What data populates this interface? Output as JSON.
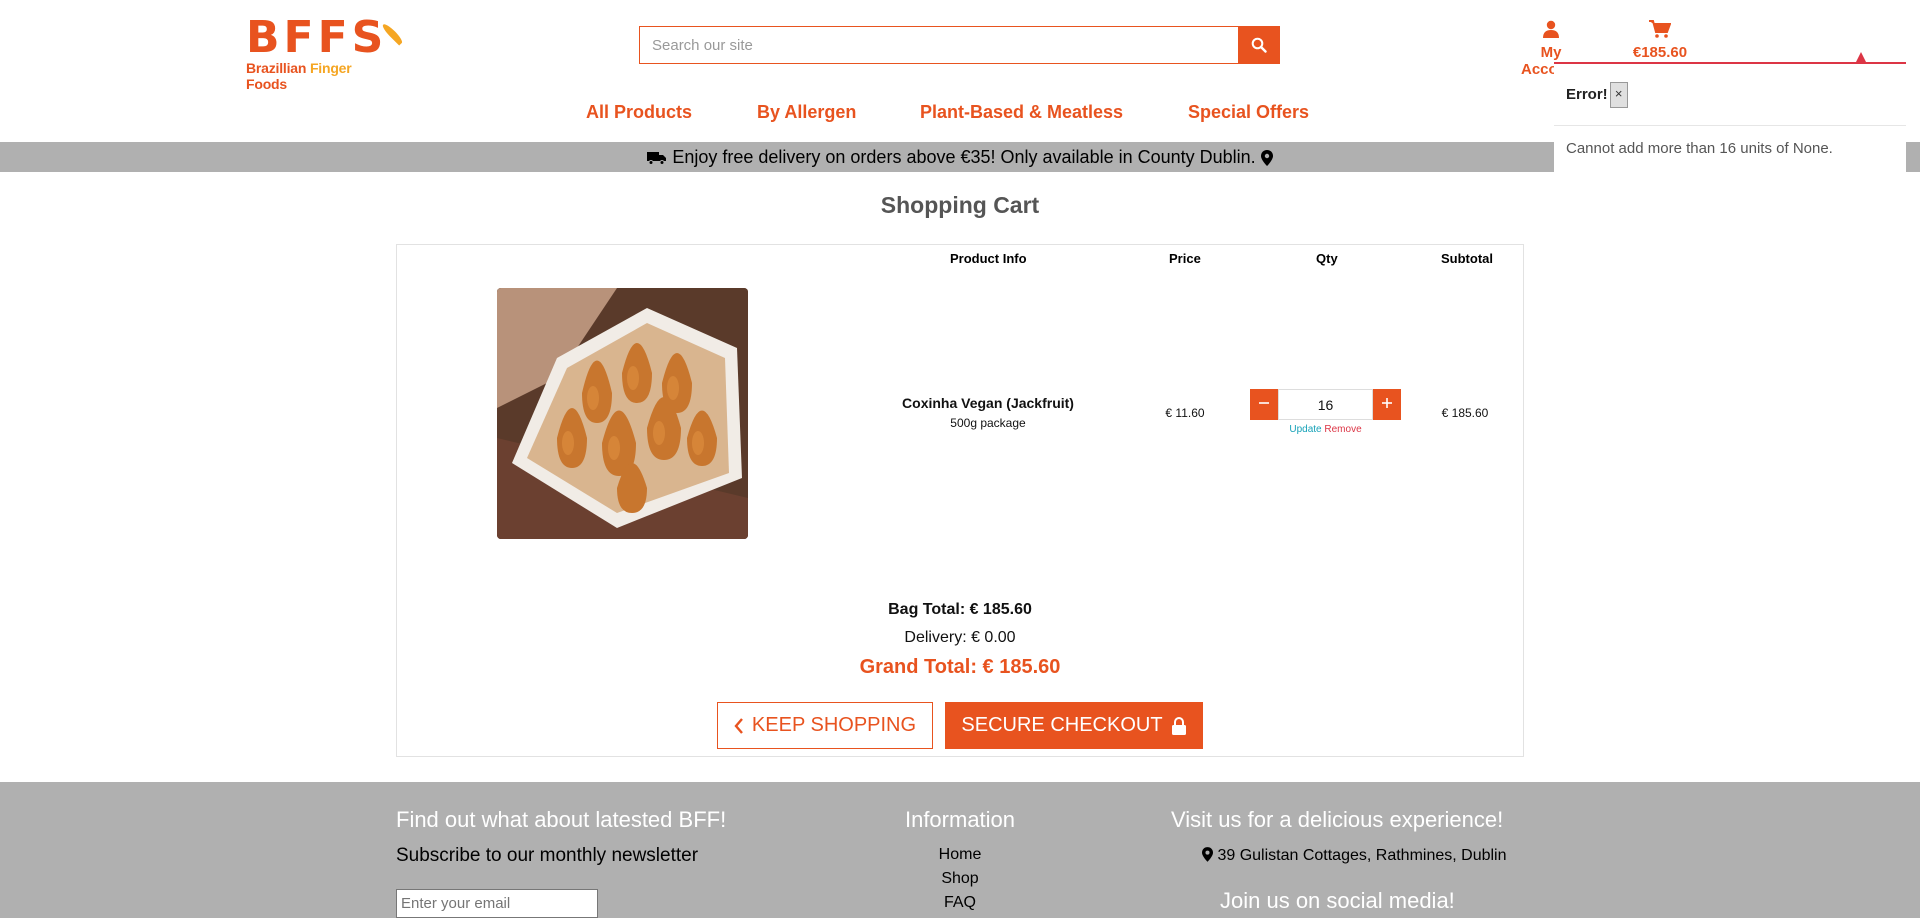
{
  "header": {
    "logo": {
      "letters": "BFFS",
      "subtitle_part1": "Brazillian ",
      "subtitle_part2": "Finger",
      "subtitle_part3": " Foods"
    },
    "search_placeholder": "Search our site",
    "account_label": "My Account",
    "cart_total": "€185.60"
  },
  "nav": [
    {
      "label": "All Products"
    },
    {
      "label": "By Allergen"
    },
    {
      "label": "Plant-Based & Meatless"
    },
    {
      "label": "Special Offers"
    }
  ],
  "banner": {
    "text": "Enjoy free delivery on orders above €35! Only available in County Dublin."
  },
  "error_popover": {
    "title": "Error!",
    "close": "×",
    "message": "Cannot add more than 16 units of None."
  },
  "cart": {
    "title": "Shopping Cart",
    "columns": [
      "Product Info",
      "Price",
      "Qty",
      "Subtotal"
    ],
    "items": [
      {
        "name": "Coxinha Vegan (Jackfruit)",
        "package": "500g package",
        "price": "€ 11.60",
        "qty": "16",
        "update": "Update",
        "remove": "Remove",
        "subtotal": "€ 185.60"
      }
    ],
    "bag_total": "Bag Total: € 185.60",
    "delivery": "Delivery: € 0.00",
    "grand_total": "Grand Total: € 185.60",
    "keep_shopping": "KEEP SHOPPING",
    "secure_checkout": "SECURE CHECKOUT"
  },
  "footer": {
    "newsletter_heading": "Find out what about latested BFF!",
    "newsletter_sub": "Subscribe to our monthly newsletter",
    "email_placeholder": "Enter your email",
    "info_heading": "Information",
    "links": [
      "Home",
      "Shop",
      "FAQ"
    ],
    "visit_heading": "Visit us for a delicious experience!",
    "address": "39 Gulistan Cottages, Rathmines, Dublin",
    "social_heading": "Join us on social media!"
  },
  "colors": {
    "brand": "#e8531f",
    "brand_yellow": "#f5a623",
    "banner_bg": "#b0b0b0",
    "error": "#dc3545",
    "info": "#17a2b8"
  }
}
